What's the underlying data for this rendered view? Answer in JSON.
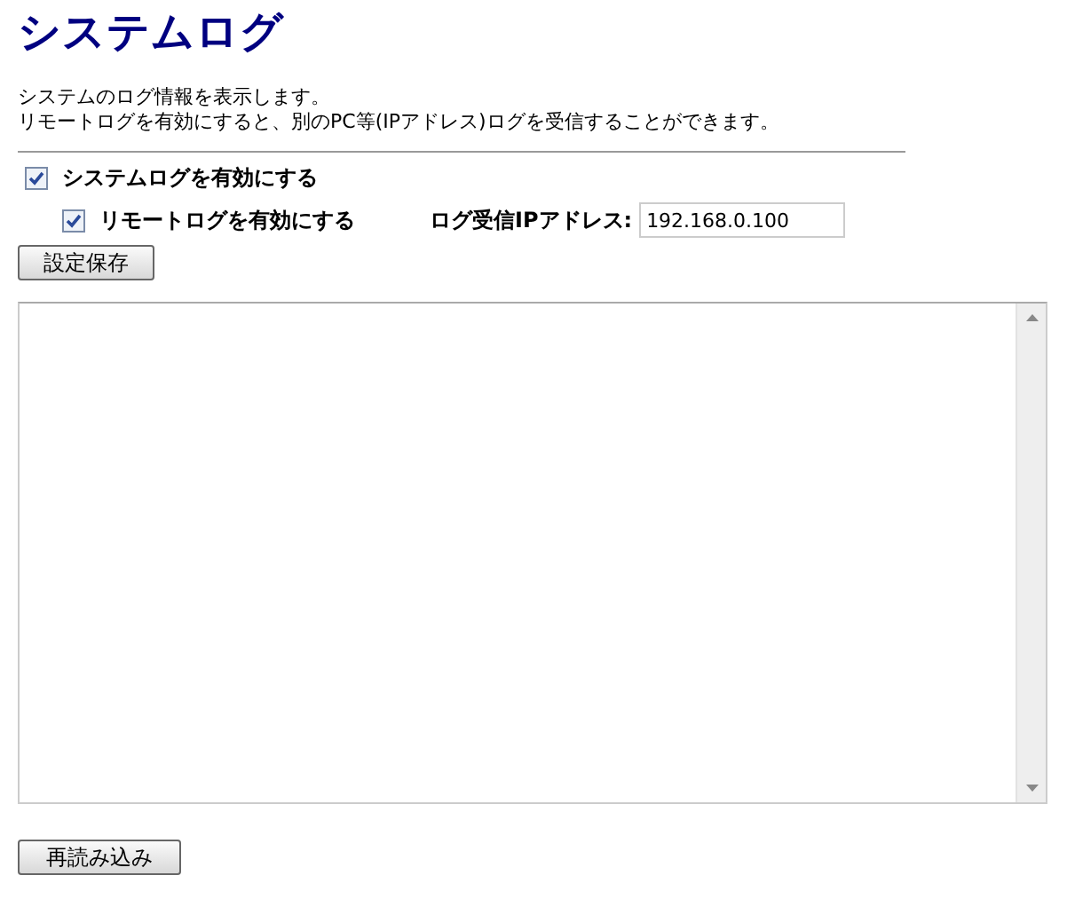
{
  "title": "システムログ",
  "description": [
    "システムのログ情報を表示します。",
    "リモートログを有効にすると、別のPC等(IPアドレス)ログを受信することができます。"
  ],
  "system_log": {
    "label": "システムログを有効にする",
    "checked": true
  },
  "remote_log": {
    "label": "リモートログを有効にする",
    "checked": true
  },
  "ip_field": {
    "label": "ログ受信IPアドレス:",
    "value": "192.168.0.100"
  },
  "save_button": "設定保存",
  "reload_button": "再読み込み"
}
